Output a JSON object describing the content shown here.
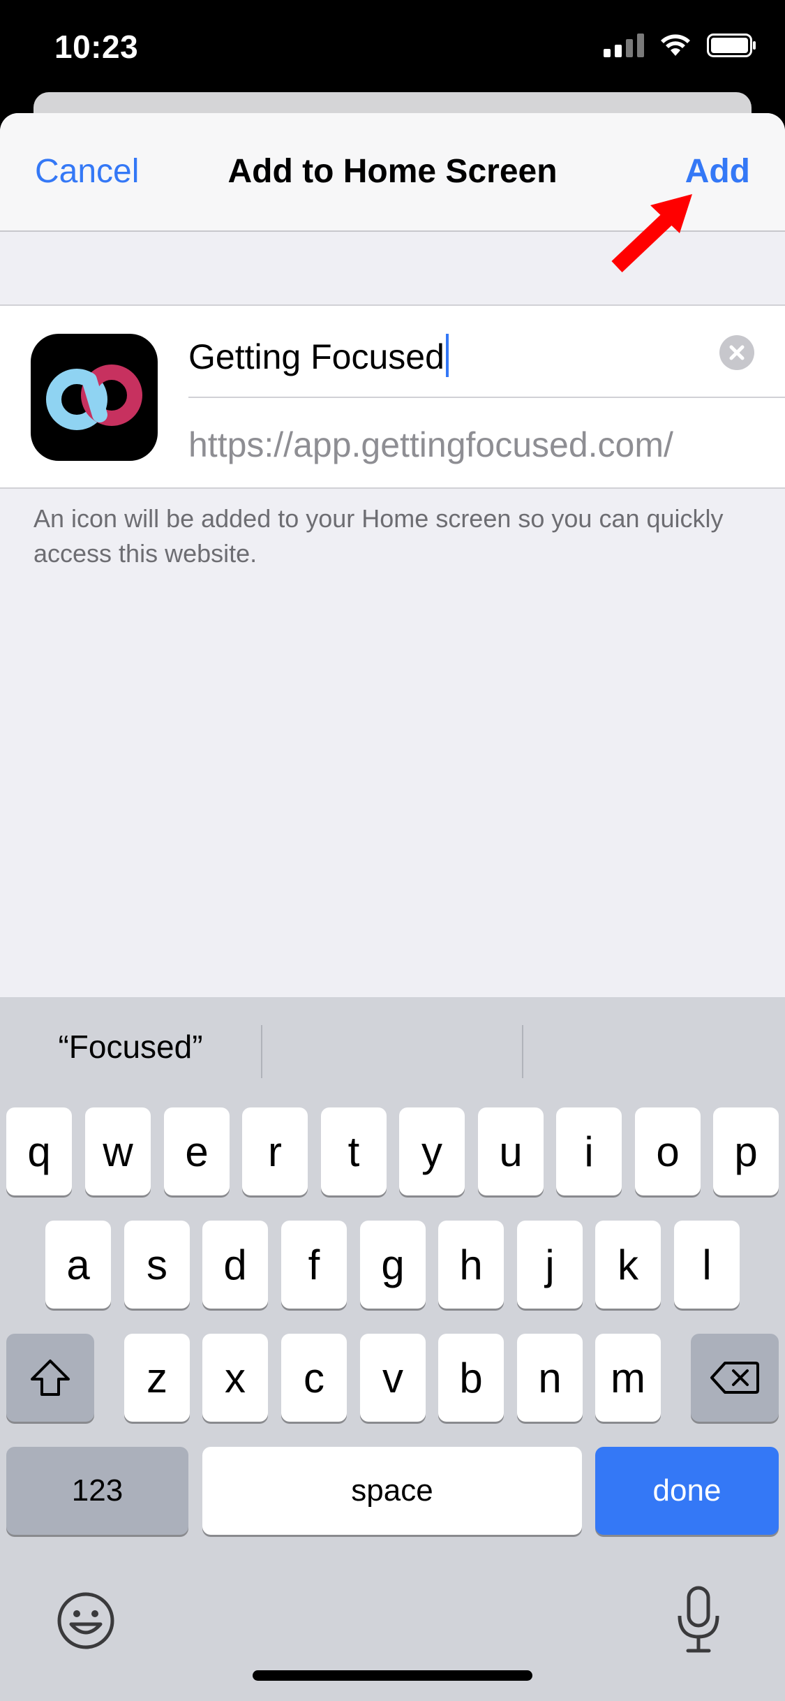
{
  "status_bar": {
    "time": "10:23",
    "icons": [
      "signal-icon",
      "wifi-icon",
      "battery-icon"
    ]
  },
  "nav": {
    "cancel_label": "Cancel",
    "title": "Add to Home Screen",
    "add_label": "Add"
  },
  "form": {
    "name_value": "Getting Focused",
    "url_value": "https://app.gettingfocused.com/",
    "app_icon": "getting-focused-logo"
  },
  "footnote": "An icon will be added to your Home screen so you can quickly access this website.",
  "keyboard": {
    "suggestions": [
      "“Focused”",
      "",
      ""
    ],
    "row1": [
      "q",
      "w",
      "e",
      "r",
      "t",
      "y",
      "u",
      "i",
      "o",
      "p"
    ],
    "row2": [
      "a",
      "s",
      "d",
      "f",
      "g",
      "h",
      "j",
      "k",
      "l"
    ],
    "row3": [
      "z",
      "x",
      "c",
      "v",
      "b",
      "n",
      "m"
    ],
    "numbers_label": "123",
    "space_label": "space",
    "done_label": "done"
  },
  "colors": {
    "accent": "#3478f6",
    "annotation_arrow": "#ff0000"
  }
}
